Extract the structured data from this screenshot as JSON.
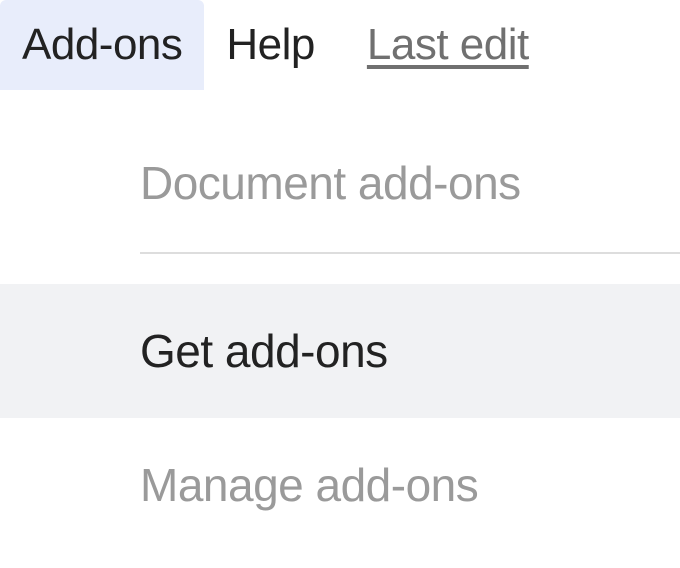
{
  "menubar": {
    "addons_label": "Add-ons",
    "help_label": "Help",
    "last_edit_label": "Last edit"
  },
  "dropdown": {
    "section_header": "Document add-ons",
    "get_addons": "Get add-ons",
    "manage_addons": "Manage add-ons"
  }
}
